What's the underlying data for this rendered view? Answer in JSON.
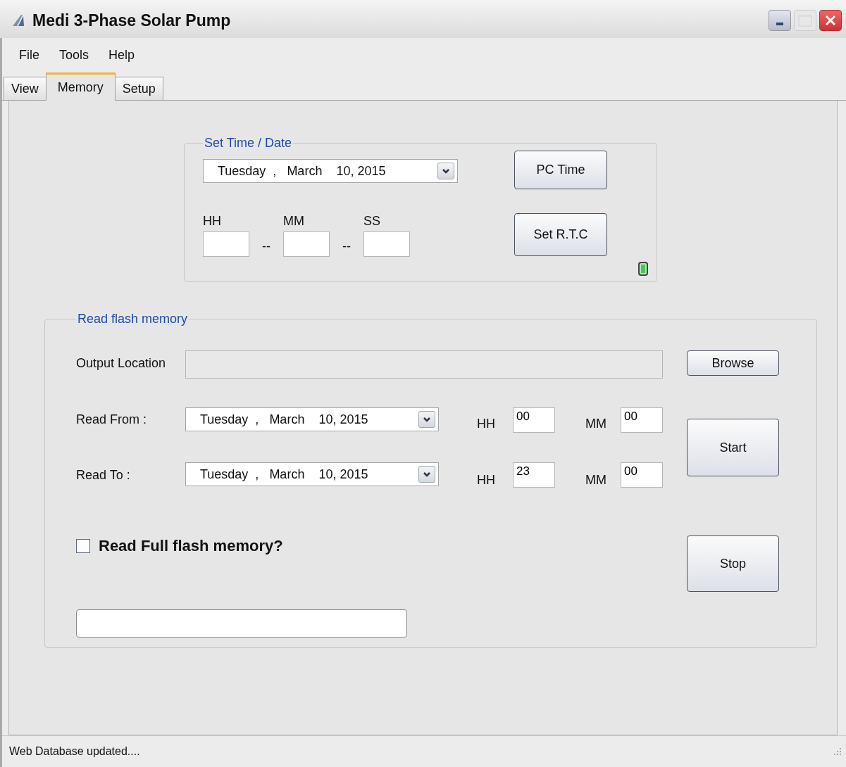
{
  "window": {
    "title": "Medi 3-Phase Solar Pump"
  },
  "menu": [
    "File",
    "Tools",
    "Help"
  ],
  "tabs": [
    {
      "label": "View",
      "selected": false
    },
    {
      "label": "Memory",
      "selected": true
    },
    {
      "label": "Setup",
      "selected": false
    }
  ],
  "set_time": {
    "legend": "Set Time / Date",
    "date": "Tuesday  ,   March    10, 2015",
    "hh_label": "HH",
    "mm_label": "MM",
    "ss_label": "SS",
    "separator_1": "--",
    "separator_2": "--",
    "pc_time_button": "PC Time",
    "set_rtc_button": "Set R.T.C",
    "indicator_on": true
  },
  "read_flash": {
    "legend": "Read flash memory",
    "output_label": "Output Location",
    "browse_button": "Browse",
    "rows": [
      {
        "label": "Read From :",
        "date": "Tuesday  ,   March    10, 2015",
        "hh_label": "HH",
        "hh": "00",
        "mm_label": "MM",
        "mm": "00"
      },
      {
        "label": "Read To :",
        "date": "Tuesday  ,   March    10, 2015",
        "hh_label": "HH",
        "hh": "23",
        "mm_label": "MM",
        "mm": "00"
      }
    ],
    "start_button": "Start",
    "full_read": {
      "label": "Read Full flash memory?",
      "checked": false
    },
    "stop_button": "Stop"
  },
  "status_bar": "Web Database updated...."
}
